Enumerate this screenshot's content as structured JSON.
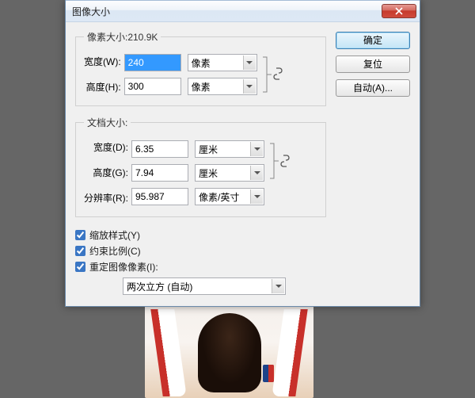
{
  "window": {
    "title": "图像大小"
  },
  "buttons": {
    "ok": "确定",
    "reset": "复位",
    "auto": "自动(A)..."
  },
  "pixel_group": {
    "legend": "像素大小:210.9K",
    "width_label": "宽度(W):",
    "width_value": "240",
    "width_unit": "像素",
    "height_label": "高度(H):",
    "height_value": "300",
    "height_unit": "像素"
  },
  "doc_group": {
    "legend": "文档大小:",
    "width_label": "宽度(D):",
    "width_value": "6.35",
    "width_unit": "厘米",
    "height_label": "高度(G):",
    "height_value": "7.94",
    "height_unit": "厘米",
    "res_label": "分辨率(R):",
    "res_value": "95.987",
    "res_unit": "像素/英寸"
  },
  "checks": {
    "scale_styles": "缩放样式(Y)",
    "constrain": "约束比例(C)",
    "resample": "重定图像像素(I):"
  },
  "resample_method": "两次立方 (自动)"
}
